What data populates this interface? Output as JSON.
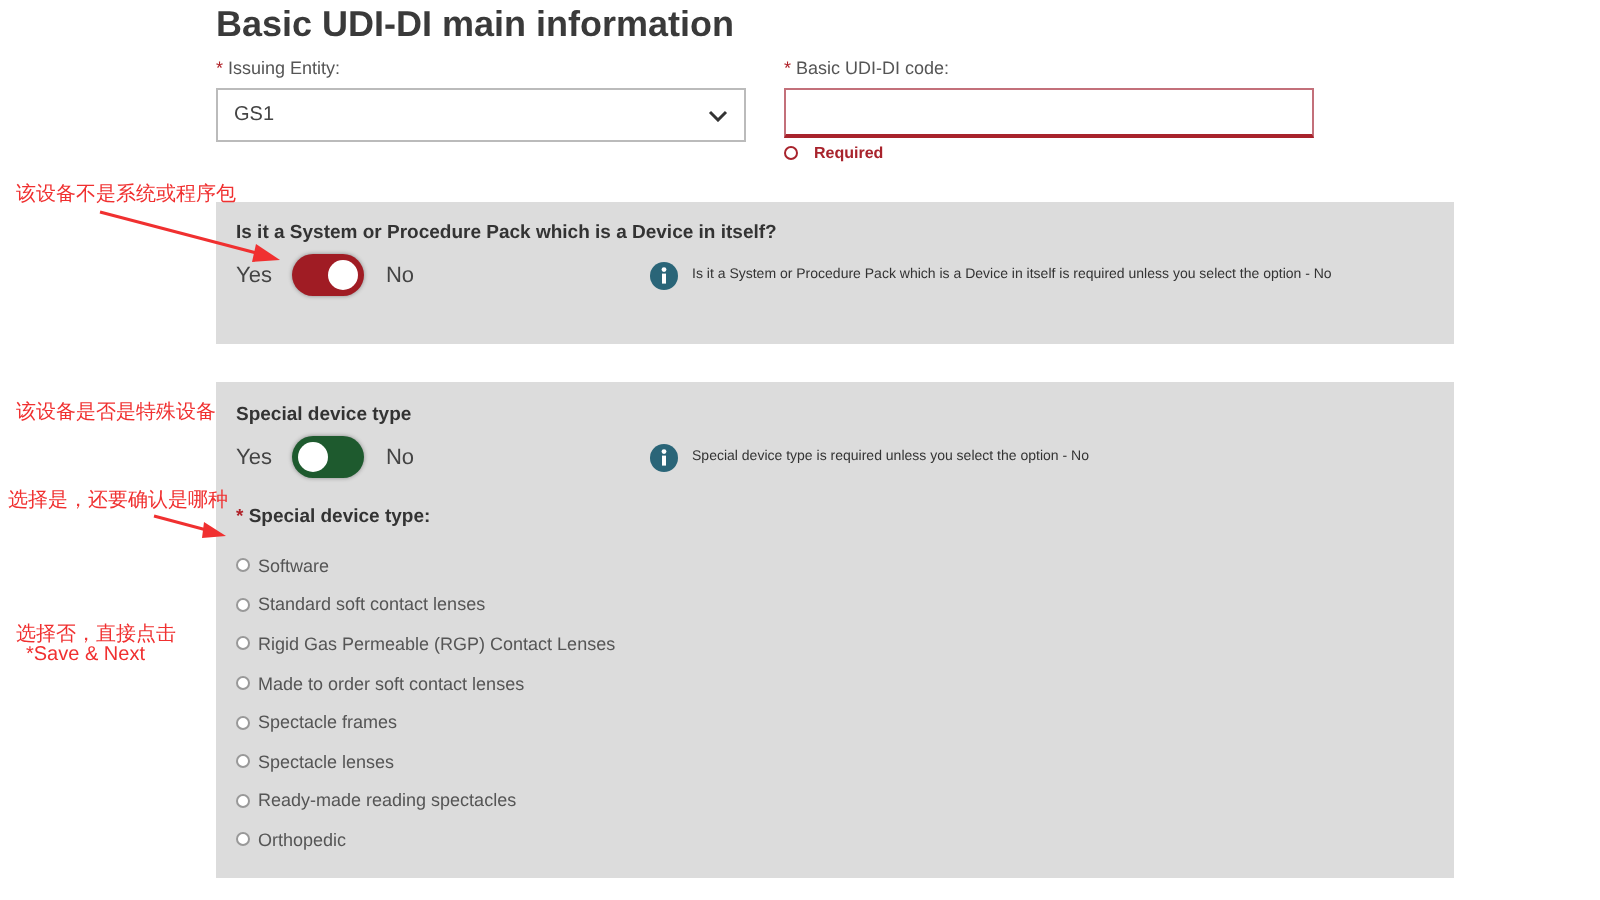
{
  "title": "Basic UDI-DI main information",
  "fields": [
    {
      "kind": "select",
      "mark": "*",
      "label": "Issuing Entity:",
      "value": "GS1"
    },
    {
      "kind": "text",
      "mark": "*",
      "label": "Basic UDI-DI code:",
      "error_text": "Required"
    }
  ],
  "panels": [
    {
      "question": "Is it a System or Procedure Pack which is a Device in itself?",
      "yes": "Yes",
      "no": "No",
      "on": true,
      "info": "Is it a System or Procedure Pack which is a Device in itself is required unless you select the option - No"
    },
    {
      "question": "Special device type",
      "yes": "Yes",
      "no": "No",
      "on": false,
      "info": "Special device type is required unless you select the option - No",
      "options_mark": "*",
      "options_label": "Special device type:",
      "options": [
        {
          "label": "Software",
          "selected": false
        },
        {
          "label": "Standard soft contact lenses",
          "selected": false
        },
        {
          "label": "Rigid Gas Permeable (RGP) Contact Lenses",
          "selected": false
        },
        {
          "label": "Made to order soft contact lenses",
          "selected": false
        },
        {
          "label": "Spectacle frames",
          "selected": false
        },
        {
          "label": "Spectacle lenses",
          "selected": false
        },
        {
          "label": "Ready-made reading spectacles",
          "selected": false
        },
        {
          "label": "Orthopedic",
          "selected": false
        }
      ]
    }
  ],
  "annotations": [
    "该设备不是系统或程序包",
    "该设备是否是特殊设备",
    "选择是，还要确认是哪种",
    "选择否，直接点击",
    "*Save & Next"
  ]
}
